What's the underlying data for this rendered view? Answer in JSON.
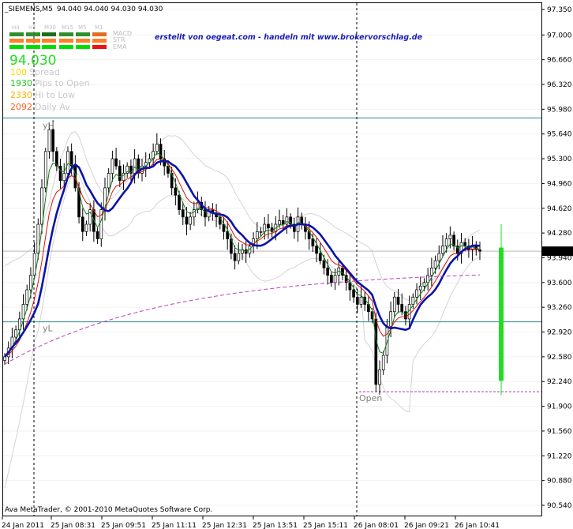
{
  "chart_data": {
    "type": "candlestick",
    "header": {
      "symbol_tf": "_SIEMENS,M5",
      "ohlc": "94.040 94.040 94.030 94.030"
    },
    "banner": "erstellt von oegeat.com - handeln mit www.brokervorschlag.de",
    "indicator_panel": {
      "timeframes": [
        "H4",
        "H1",
        "M30",
        "M15",
        "M5",
        "M1"
      ],
      "labels": [
        "MACD",
        "STR",
        "EMA"
      ],
      "rows": [
        [
          "#2f8f2f",
          "#2f8f2f",
          "#1a6e1a",
          "#2f8f2f",
          "#2f8f2f",
          "#e07020"
        ],
        [
          "#ff7f27",
          "#ff7f27",
          "#ff7f27",
          "#ff7f27",
          "#ff7f27",
          "#ff7f27"
        ],
        [
          "#00dd00",
          "#00dd00",
          "#00dd00",
          "#00dd00",
          "#00dd00",
          "#ee1111"
        ]
      ],
      "price": "94.030",
      "stats": [
        {
          "value": "100",
          "label": "Spread",
          "color": "#ffd700"
        },
        {
          "value": "1930",
          "label": "Pips to Open",
          "color": "#22cc22"
        },
        {
          "value": "2330",
          "label": "Hi to Low",
          "color": "#ffb000"
        },
        {
          "value": "2092",
          "label": "Daily Av",
          "color": "#ff6020"
        }
      ]
    },
    "level_labels": {
      "high": "yH",
      "low": "yL",
      "open": "Open"
    },
    "levels": {
      "yH": 95.86,
      "yL": 93.06,
      "open": 92.1,
      "current": 94.03
    },
    "copyright": "Ava MetaTrader, © 2001-2010 MetaQuotes Software Corp.",
    "y_ticks": [
      "97.350",
      "97.000",
      "96.660",
      "96.320",
      "95.980",
      "95.640",
      "95.300",
      "94.960",
      "94.620",
      "94.280",
      "93.940",
      "93.600",
      "93.260",
      "92.920",
      "92.580",
      "92.240",
      "91.900",
      "91.560",
      "91.220",
      "90.880",
      "90.540"
    ],
    "x_ticks": [
      "24 Jan 2011",
      "25 Jan 08:31",
      "25 Jan 09:51",
      "25 Jan 11:11",
      "25 Jan 12:31",
      "25 Jan 13:51",
      "25 Jan 15:11",
      "26 Jan 08:01",
      "26 Jan 09:21",
      "26 Jan 10:41"
    ],
    "ylim": [
      90.54,
      97.35
    ],
    "closes": [
      92.58,
      92.7,
      92.85,
      92.95,
      93.1,
      93.3,
      93.5,
      93.7,
      94.0,
      94.4,
      94.9,
      95.4,
      95.7,
      95.4,
      95.2,
      95.0,
      95.1,
      95.4,
      95.2,
      94.9,
      94.5,
      94.3,
      94.4,
      94.6,
      94.3,
      94.2,
      94.6,
      94.9,
      95.1,
      95.3,
      95.2,
      95.0,
      95.1,
      95.2,
      95.1,
      95.3,
      95.1,
      95.2,
      95.25,
      95.3,
      95.4,
      95.5,
      95.3,
      95.2,
      95.1,
      94.9,
      94.8,
      94.6,
      94.5,
      94.4,
      94.5,
      94.6,
      94.7,
      94.6,
      94.5,
      94.6,
      94.55,
      94.5,
      94.4,
      94.3,
      94.2,
      94.0,
      93.9,
      94.0,
      94.05,
      94.0,
      94.1,
      94.2,
      94.3,
      94.3,
      94.4,
      94.35,
      94.3,
      94.4,
      94.45,
      94.4,
      94.5,
      94.4,
      94.3,
      94.5,
      94.4,
      94.3,
      94.2,
      94.1,
      94.0,
      93.9,
      93.8,
      93.7,
      93.6,
      93.7,
      93.8,
      93.7,
      93.6,
      93.5,
      93.4,
      93.3,
      93.4,
      93.3,
      93.2,
      93.1,
      92.2,
      92.4,
      92.6,
      93.0,
      93.2,
      93.4,
      93.3,
      93.2,
      93.1,
      93.3,
      93.4,
      93.5,
      93.55,
      93.6,
      93.7,
      93.8,
      93.9,
      94.0,
      94.1,
      94.2,
      94.25,
      94.1,
      94.0,
      94.15,
      94.1,
      94.05,
      94.1,
      94.05,
      94.03
    ],
    "bar_value": 2.3
  }
}
